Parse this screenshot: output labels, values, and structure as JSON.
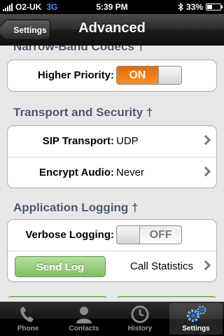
{
  "status_bar": {
    "carrier": "O2-UK",
    "network": "3G",
    "time": "5:39 PM",
    "battery": "33%",
    "battery_level": 0.33
  },
  "nav": {
    "back_label": "Settings",
    "title": "Advanced"
  },
  "sections": {
    "codecs": {
      "header": "Narrow-Band Codecs †",
      "higher_priority_label": "Higher Priority:",
      "higher_priority_value": "ON",
      "higher_priority_on": true
    },
    "transport": {
      "header": "Transport and Security †",
      "sip_label": "SIP Transport:",
      "sip_value": "UDP",
      "encrypt_label": "Encrypt Audio:",
      "encrypt_value": "Never"
    },
    "logging": {
      "header": "Application Logging †",
      "verbose_label": "Verbose Logging:",
      "verbose_value": "OFF",
      "verbose_on": false,
      "send_log_label": "Send Log",
      "call_stats_label": "Call Statistics"
    }
  },
  "tabbar": {
    "items": [
      {
        "label": "Phone",
        "icon": "phone-icon"
      },
      {
        "label": "Contacts",
        "icon": "contacts-icon"
      },
      {
        "label": "History",
        "icon": "clock-icon"
      },
      {
        "label": "Settings",
        "icon": "gears-icon",
        "active": true
      }
    ]
  },
  "colors": {
    "toggle_on": "#ff8d1f",
    "send_button": "#7fbd62",
    "section_header": "#4c566c",
    "network_3g": "#4b8df0"
  }
}
